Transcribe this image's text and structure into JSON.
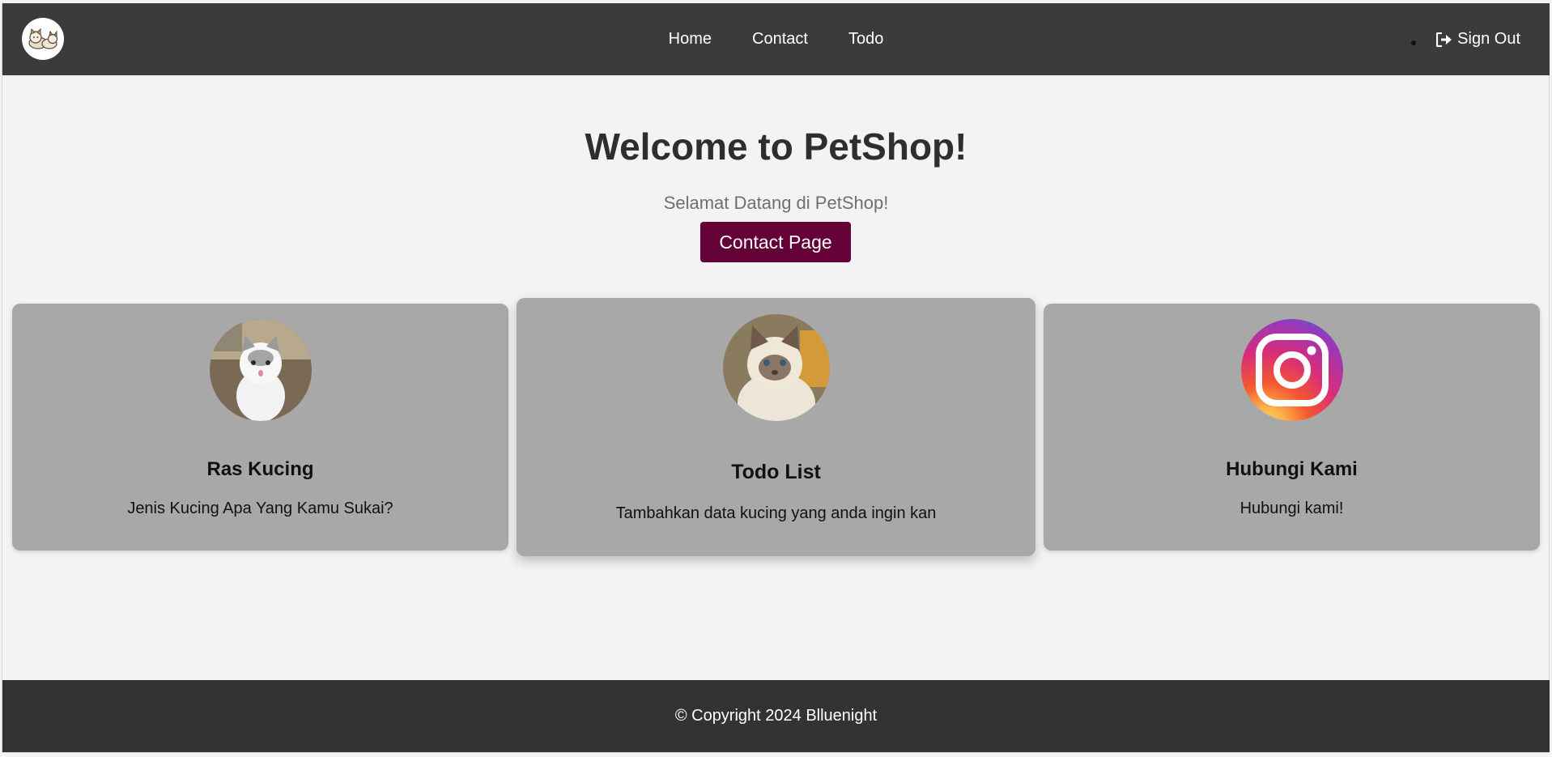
{
  "nav": {
    "logo_icon": "cat-logo-icon",
    "links": [
      {
        "label": "Home"
      },
      {
        "label": "Contact"
      },
      {
        "label": "Todo"
      }
    ],
    "signout_label": "Sign Out",
    "signout_icon": "sign-out-icon"
  },
  "hero": {
    "title": "Welcome to PetShop!",
    "subtitle": "Selamat Datang di PetShop!",
    "button_label": "Contact Page"
  },
  "cards": [
    {
      "title": "Ras Kucing",
      "text": "Jenis Kucing Apa Yang Kamu Sukai?",
      "image": "white-kitten-photo"
    },
    {
      "title": "Todo List",
      "text": "Tambahkan data kucing yang anda ingin kan",
      "image": "siamese-cat-photo"
    },
    {
      "title": "Hubungi Kami",
      "text": "Hubungi kami!",
      "image": "instagram-icon"
    }
  ],
  "footer": {
    "copyright": "© Copyright 2024 Blluenight"
  },
  "colors": {
    "header_bg": "#3b3b3b",
    "page_bg": "#f3f3f3",
    "button_bg": "#640238",
    "card_bg": "#a8a8a8",
    "footer_bg": "#333333"
  }
}
